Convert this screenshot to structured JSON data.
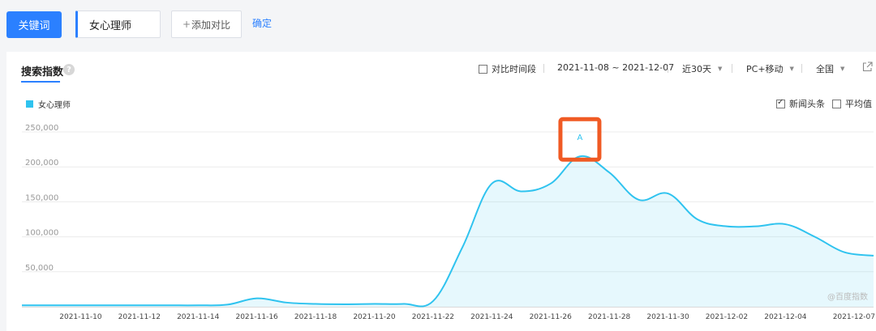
{
  "toolbar": {
    "keyword_button": "关键词",
    "keyword_value": "女心理师",
    "add_compare_plus": "+",
    "add_compare_label": "添加对比",
    "confirm_label": "确定"
  },
  "panel": {
    "tab_title": "搜索指数",
    "help_icon": "?",
    "compare_period_label": "对比时间段",
    "date_range": "2021-11-08 ~ 2021-12-07",
    "period_select": "近30天",
    "device_select": "PC+移动",
    "region_select": "全国",
    "news_headline_label": "新闻头条",
    "average_label": "平均值",
    "watermark": "@百度指数",
    "colors": {
      "accent": "#2b80ff",
      "series": "#2fc3ef",
      "highlight_box": "#f05a24"
    },
    "icons": [
      "help-icon",
      "share-icon",
      "checkbox-icon",
      "caret-down-icon"
    ]
  },
  "chart_data": {
    "type": "area",
    "ylim": [
      0,
      250000
    ],
    "yticks": [
      50000,
      100000,
      150000,
      200000,
      250000
    ],
    "ytick_labels": [
      "50,000",
      "100,000",
      "150,000",
      "200,000",
      "250,000"
    ],
    "xtick_labels": [
      "2021-11-10",
      "2021-11-12",
      "2021-11-14",
      "2021-11-16",
      "2021-11-18",
      "2021-11-20",
      "2021-11-22",
      "2021-11-24",
      "2021-11-26",
      "2021-11-28",
      "2021-11-30",
      "2021-12-02",
      "2021-12-04",
      "2021-12-07"
    ],
    "series": [
      {
        "name": "女心理师",
        "x": [
          "2021-11-08",
          "2021-11-09",
          "2021-11-10",
          "2021-11-11",
          "2021-11-12",
          "2021-11-13",
          "2021-11-14",
          "2021-11-15",
          "2021-11-16",
          "2021-11-17",
          "2021-11-18",
          "2021-11-19",
          "2021-11-20",
          "2021-11-21",
          "2021-11-22",
          "2021-11-23",
          "2021-11-24",
          "2021-11-25",
          "2021-11-26",
          "2021-11-27",
          "2021-11-28",
          "2021-11-29",
          "2021-11-30",
          "2021-12-01",
          "2021-12-02",
          "2021-12-03",
          "2021-12-04",
          "2021-12-05",
          "2021-12-06",
          "2021-12-07"
        ],
        "values": [
          2000,
          2000,
          2000,
          2000,
          2000,
          2000,
          2000,
          3000,
          12000,
          6000,
          4000,
          3500,
          4000,
          4000,
          8000,
          85000,
          176000,
          165000,
          176000,
          215000,
          192000,
          153000,
          162000,
          125000,
          115000,
          115000,
          118000,
          100000,
          78000,
          73000
        ]
      }
    ],
    "annotations": [
      {
        "label": "A",
        "x": "2021-11-27",
        "value": 215000
      }
    ]
  }
}
